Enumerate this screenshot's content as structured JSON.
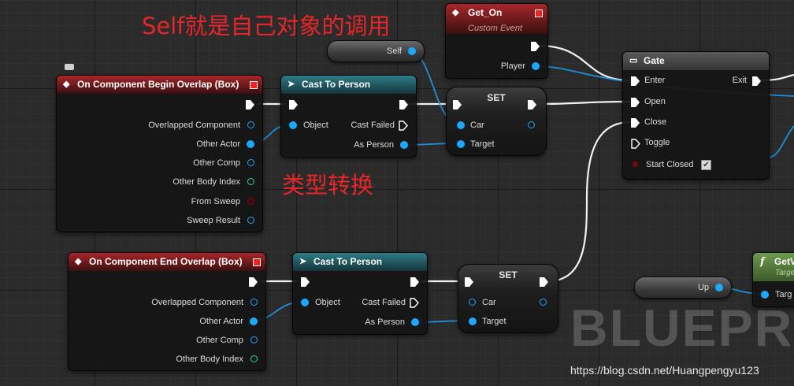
{
  "annotations": {
    "self_note": "Self就是自己对象的调用",
    "cast_note": "类型转换"
  },
  "watermark": "BLUEPRI",
  "credit": "https://blog.csdn.net/Huangpengyu123",
  "self_var": {
    "label": "Self"
  },
  "up_var": {
    "label": "Up"
  },
  "get_on": {
    "title": "Get_On",
    "subtitle": "Custom Event",
    "player_label": "Player"
  },
  "gate": {
    "title": "Gate",
    "enter": "Enter",
    "open": "Open",
    "close": "Close",
    "toggle": "Toggle",
    "start_closed": "Start Closed",
    "exit": "Exit",
    "start_closed_checked": true
  },
  "begin_overlap": {
    "title": "On Component Begin Overlap (Box)",
    "pins": [
      "Overlapped Component",
      "Other Actor",
      "Other Comp",
      "Other Body Index",
      "From Sweep",
      "Sweep Result"
    ]
  },
  "end_overlap": {
    "title": "On Component End Overlap (Box)",
    "pins": [
      "Overlapped Component",
      "Other Actor",
      "Other Comp",
      "Other Body Index"
    ]
  },
  "cast1": {
    "title": "Cast To Person",
    "object": "Object",
    "cast_failed": "Cast Failed",
    "as_person": "As Person"
  },
  "cast2": {
    "title": "Cast To Person",
    "object": "Object",
    "cast_failed": "Cast Failed",
    "as_person": "As Person"
  },
  "set1": {
    "title": "SET",
    "car": "Car",
    "target": "Target"
  },
  "set2": {
    "title": "SET",
    "car": "Car",
    "target": "Target"
  },
  "func_node": {
    "title": "GetV",
    "target_sub": "Targe",
    "target_pin": "Targ"
  },
  "colors": {
    "exec": "#ffffff",
    "object_pin": "#1ea7ff",
    "int_pin": "#2fd59a",
    "bool_pin": "#7a1010",
    "event_header": "#a8262a",
    "cast_header": "#2e7c86",
    "annotation": "#e8262a"
  }
}
